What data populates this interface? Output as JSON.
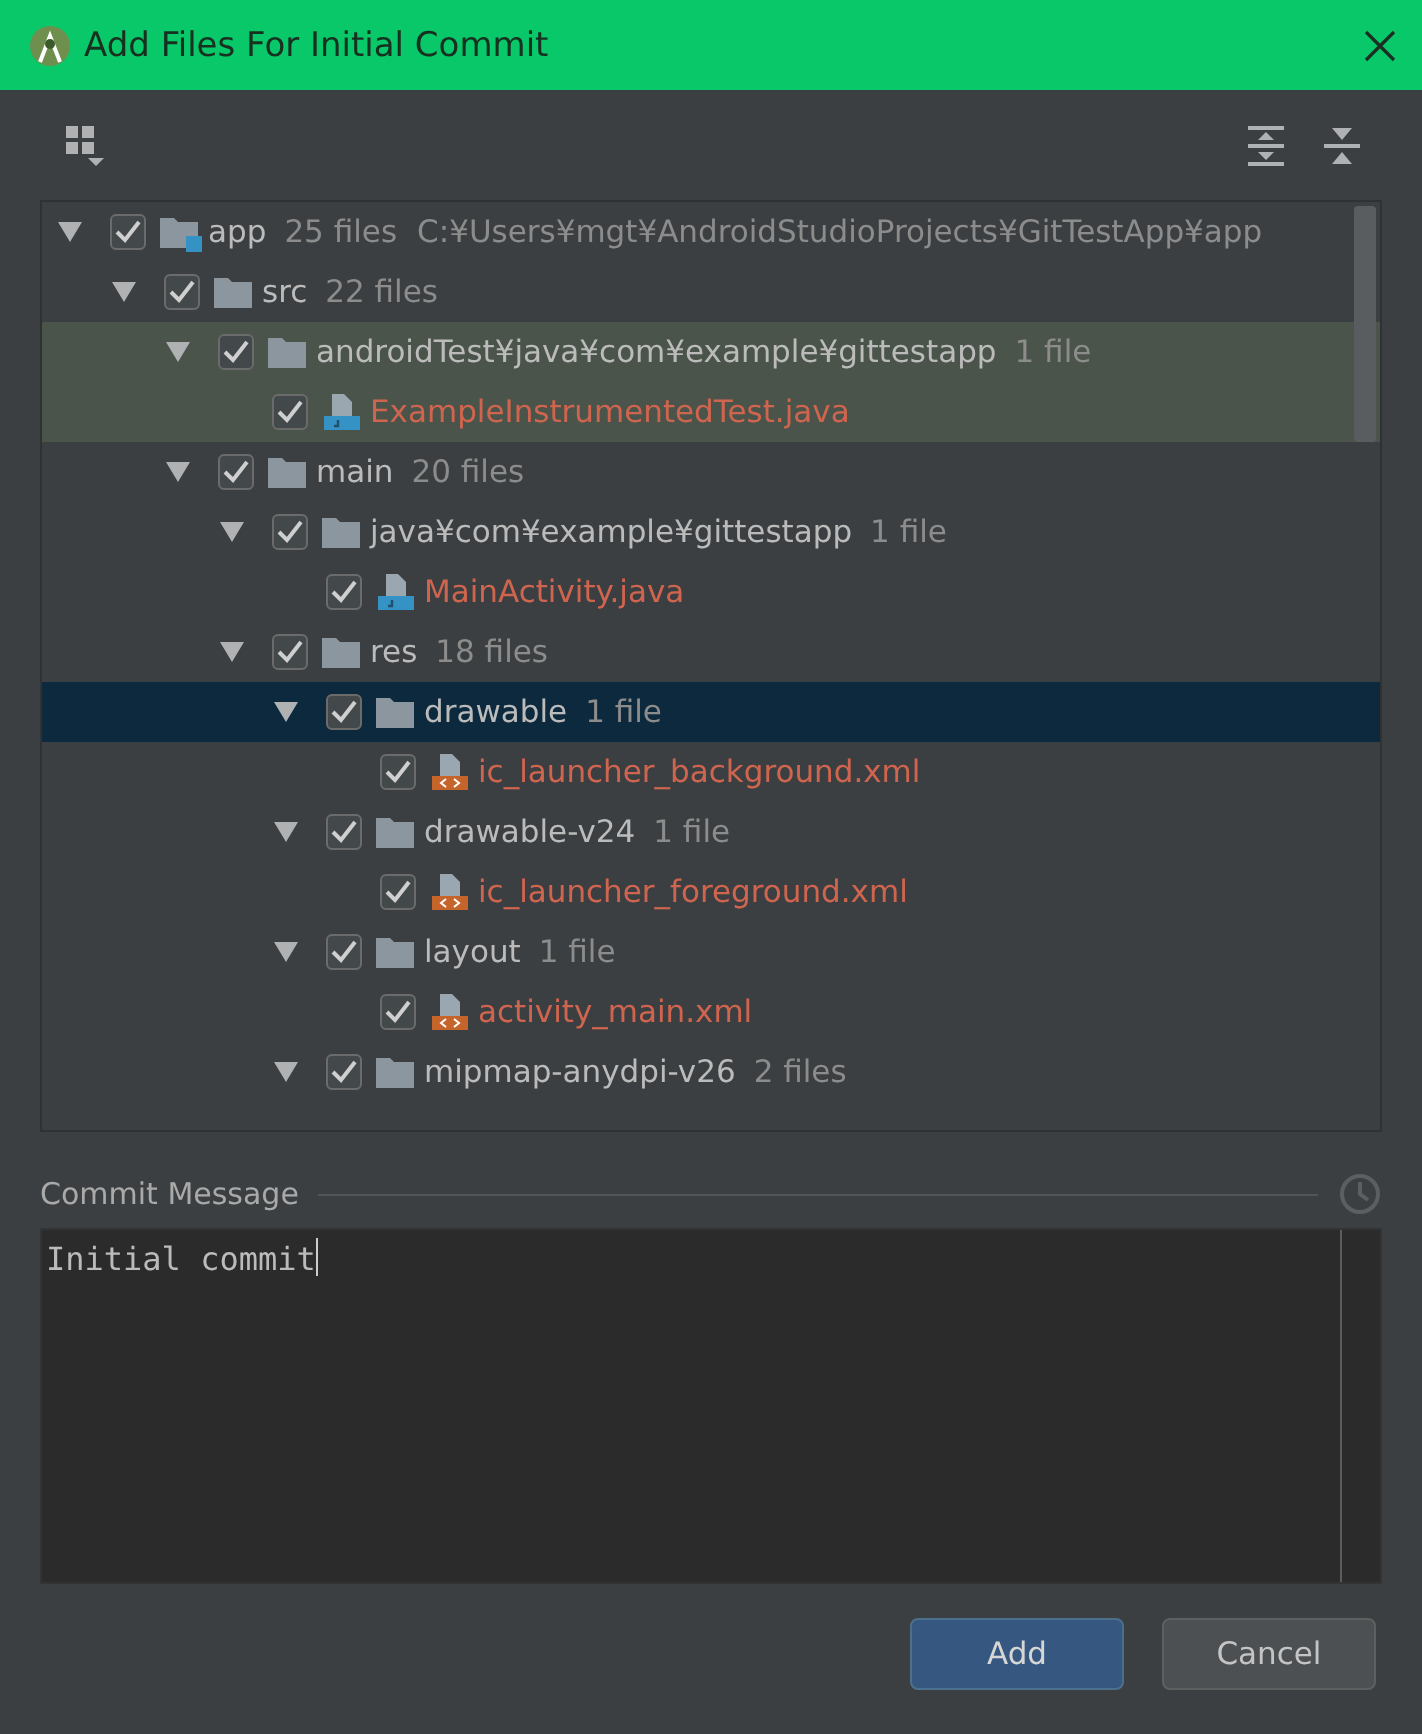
{
  "window": {
    "title": "Add Files For Initial Commit"
  },
  "tree": [
    {
      "kind": "module",
      "name": "app",
      "count": "25 files",
      "path": "C:¥Users¥mgt¥AndroidStudioProjects¥GitTestApp¥app",
      "checked": true,
      "expanded": true,
      "selected": false,
      "children": [
        {
          "kind": "folder",
          "name": "src",
          "count": "22 files",
          "checked": true,
          "expanded": true,
          "selected": false,
          "children": [
            {
              "kind": "folder",
              "name": "androidTest¥java¥com¥example¥gittestapp",
              "count": "1 file",
              "checked": true,
              "expanded": true,
              "selected": false,
              "test_source": true,
              "children": [
                {
                  "kind": "java",
                  "name": "ExampleInstrumentedTest.java",
                  "checked": true,
                  "selected": false
                }
              ]
            },
            {
              "kind": "folder",
              "name": "main",
              "count": "20 files",
              "checked": true,
              "expanded": true,
              "selected": false,
              "children": [
                {
                  "kind": "folder",
                  "name": "java¥com¥example¥gittestapp",
                  "count": "1 file",
                  "checked": true,
                  "expanded": true,
                  "selected": false,
                  "children": [
                    {
                      "kind": "java",
                      "name": "MainActivity.java",
                      "checked": true,
                      "selected": false
                    }
                  ]
                },
                {
                  "kind": "folder",
                  "name": "res",
                  "count": "18 files",
                  "checked": true,
                  "expanded": true,
                  "selected": false,
                  "children": [
                    {
                      "kind": "folder",
                      "name": "drawable",
                      "count": "1 file",
                      "checked": true,
                      "expanded": true,
                      "selected": true,
                      "children": [
                        {
                          "kind": "xml",
                          "name": "ic_launcher_background.xml",
                          "checked": true,
                          "selected": false
                        }
                      ]
                    },
                    {
                      "kind": "folder",
                      "name": "drawable-v24",
                      "count": "1 file",
                      "checked": true,
                      "expanded": true,
                      "selected": false,
                      "children": [
                        {
                          "kind": "xml",
                          "name": "ic_launcher_foreground.xml",
                          "checked": true,
                          "selected": false
                        }
                      ]
                    },
                    {
                      "kind": "folder",
                      "name": "layout",
                      "count": "1 file",
                      "checked": true,
                      "expanded": true,
                      "selected": false,
                      "children": [
                        {
                          "kind": "xml",
                          "name": "activity_main.xml",
                          "checked": true,
                          "selected": false
                        }
                      ]
                    },
                    {
                      "kind": "folder",
                      "name": "mipmap-anydpi-v26",
                      "count": "2 files",
                      "checked": true,
                      "expanded": true,
                      "selected": false
                    }
                  ]
                }
              ]
            }
          ]
        }
      ]
    }
  ],
  "commit": {
    "label": "Commit Message",
    "value": "Initial commit"
  },
  "buttons": [
    {
      "label": "Add",
      "kind": "primary"
    },
    {
      "label": "Cancel",
      "kind": "secondary"
    }
  ]
}
